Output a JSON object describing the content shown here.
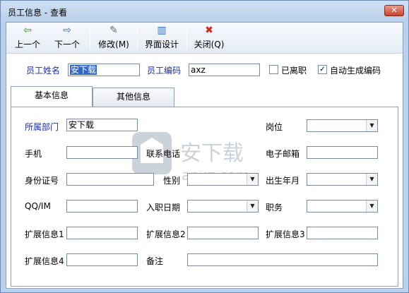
{
  "window": {
    "title": "员工信息 - 查看",
    "close_glyph": "✕"
  },
  "toolbar": {
    "items": [
      {
        "label": "上一个",
        "icon": "arrow-left-icon",
        "glyph": "⇦",
        "color": "#2e9b2e"
      },
      {
        "label": "下一个",
        "icon": "arrow-right-icon",
        "glyph": "⇨",
        "color": "#2d6fd0"
      },
      {
        "label": "修改(M)",
        "icon": "edit-icon",
        "glyph": "✎",
        "color": "#6a6a6a"
      },
      {
        "label": "界面设计",
        "icon": "layout-icon",
        "glyph": "▥",
        "color": "#2a6bc1"
      },
      {
        "label": "关闭(Q)",
        "icon": "close-icon",
        "glyph": "✖",
        "color": "#d02a1a"
      }
    ]
  },
  "header": {
    "name_label": "员工姓名",
    "name_value": "安下载",
    "code_label": "员工编码",
    "code_value": "axz",
    "resigned_label": "已离职",
    "resigned_checked": false,
    "autocode_label": "自动生成编码",
    "autocode_checked": true
  },
  "tabs": [
    {
      "label": "基本信息",
      "active": true
    },
    {
      "label": "其他信息",
      "active": false
    }
  ],
  "form": {
    "dept_label": "所属部门",
    "dept_value": "安下载",
    "position_label": "岗位",
    "position_value": "",
    "phone_label": "手机",
    "phone_value": "",
    "contact_phone_label": "联系电话",
    "email_label": "电子邮箱",
    "email_value": "",
    "id_label": "身份证号",
    "id_value": "",
    "gender_label": "性别",
    "gender_value": "",
    "birth_label": "出生年月",
    "birth_value": "",
    "qq_label": "QQ/IM",
    "qq_value": "",
    "entry_label": "入职日期",
    "entry_value": "",
    "duty_label": "职务",
    "duty_value": "",
    "ext1_label": "扩展信息1",
    "ext2_label": "扩展信息2",
    "ext3_label": "扩展信息3",
    "ext4_label": "扩展信息4",
    "note_label": "备注"
  },
  "watermark": {
    "text": "安下载",
    "sub": "anxz.com"
  },
  "colors": {
    "title_bar": "#b9d1ea",
    "label_blue": "#1b2ea8",
    "selection": "#3169c6"
  }
}
